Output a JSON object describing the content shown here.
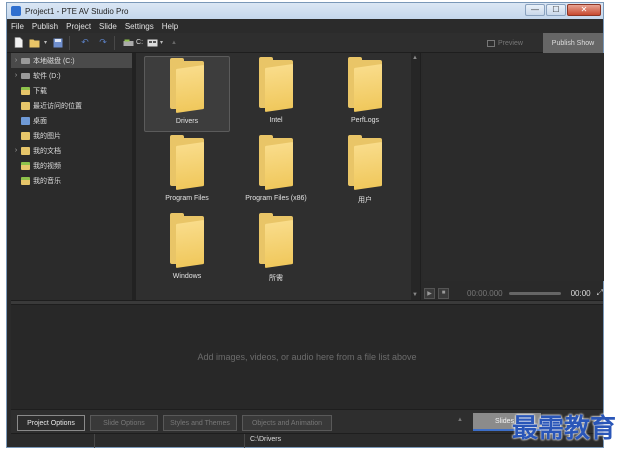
{
  "window": {
    "title": "Project1 - PTE AV Studio Pro",
    "controls": {
      "minimize": "—",
      "maximize": "☐",
      "close": "✕"
    }
  },
  "menu": [
    "File",
    "Publish",
    "Project",
    "Slide",
    "Settings",
    "Help"
  ],
  "toolbar": {
    "drive_label": "C:",
    "preview_label": "Preview",
    "publish_show_label": "Publish Show"
  },
  "tree": {
    "items": [
      {
        "label": "本地磁盘 (C:)",
        "expandable": true,
        "selected": true,
        "icon": "drive-icon"
      },
      {
        "label": "软件 (D:)",
        "expandable": true,
        "selected": false,
        "icon": "drive-icon"
      },
      {
        "label": "下载",
        "expandable": false,
        "selected": false,
        "icon": "downloads-folder-icon"
      },
      {
        "label": "最近访问的位置",
        "expandable": false,
        "selected": false,
        "icon": "recent-folder-icon"
      },
      {
        "label": "桌面",
        "expandable": false,
        "selected": false,
        "icon": "desktop-folder-icon"
      },
      {
        "label": "我的图片",
        "expandable": false,
        "selected": false,
        "icon": "pictures-folder-icon"
      },
      {
        "label": "我的文档",
        "expandable": true,
        "selected": false,
        "icon": "documents-folder-icon"
      },
      {
        "label": "我的视频",
        "expandable": false,
        "selected": false,
        "icon": "videos-folder-icon"
      },
      {
        "label": "我的音乐",
        "expandable": false,
        "selected": false,
        "icon": "music-folder-icon"
      }
    ]
  },
  "files": [
    {
      "label": "Drivers",
      "selected": true
    },
    {
      "label": "Intel",
      "selected": false
    },
    {
      "label": "PerfLogs",
      "selected": false
    },
    {
      "label": "Program Files",
      "selected": false
    },
    {
      "label": "Program Files (x86)",
      "selected": false
    },
    {
      "label": "用户",
      "selected": false
    },
    {
      "label": "Windows",
      "selected": false
    },
    {
      "label": "所需",
      "selected": false
    }
  ],
  "player": {
    "time_start": "00:00.000",
    "time_end": "00:00"
  },
  "slide_area": {
    "hint": "Add images, videos, or audio here from a file list above"
  },
  "bottom": {
    "project_options": "Project Options",
    "slide_options": "Slide Options",
    "styles_themes": "Styles and Themes",
    "objects_animation": "Objects and Animation",
    "slides_tab": "Slides"
  },
  "status": {
    "path": "C:\\Drivers"
  },
  "watermark": "最需教育"
}
